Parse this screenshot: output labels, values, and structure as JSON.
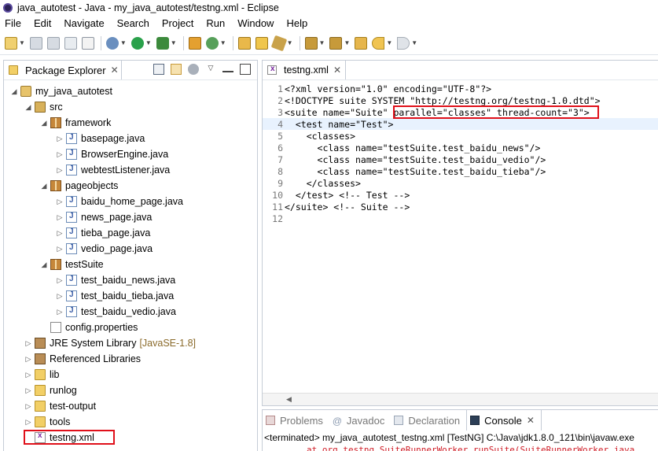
{
  "window": {
    "title": "java_autotest - Java - my_java_autotest/testng.xml - Eclipse"
  },
  "menubar": {
    "items": [
      "File",
      "Edit",
      "Navigate",
      "Search",
      "Project",
      "Run",
      "Window",
      "Help"
    ]
  },
  "package_explorer": {
    "tab_label": "Package Explorer",
    "tree": [
      {
        "label": "my_java_autotest",
        "icon": "project-icon"
      },
      {
        "label": "src",
        "icon": "source-folder-icon"
      },
      {
        "label": "framework",
        "icon": "package-icon"
      },
      {
        "label": "basepage.java",
        "icon": "java-file-icon"
      },
      {
        "label": "BrowserEngine.java",
        "icon": "java-file-icon"
      },
      {
        "label": "webtestListener.java",
        "icon": "java-file-icon"
      },
      {
        "label": "pageobjects",
        "icon": "package-icon"
      },
      {
        "label": "baidu_home_page.java",
        "icon": "java-file-icon"
      },
      {
        "label": "news_page.java",
        "icon": "java-file-icon"
      },
      {
        "label": "tieba_page.java",
        "icon": "java-file-icon"
      },
      {
        "label": "vedio_page.java",
        "icon": "java-file-icon"
      },
      {
        "label": "testSuite",
        "icon": "package-icon"
      },
      {
        "label": "test_baidu_news.java",
        "icon": "java-file-icon"
      },
      {
        "label": "test_baidu_tieba.java",
        "icon": "java-file-icon"
      },
      {
        "label": "test_baidu_vedio.java",
        "icon": "java-file-icon"
      },
      {
        "label": "config.properties",
        "icon": "properties-file-icon"
      },
      {
        "label": "JRE System Library",
        "tag": "[JavaSE-1.8]",
        "icon": "library-icon"
      },
      {
        "label": "Referenced Libraries",
        "icon": "library-icon"
      },
      {
        "label": "lib",
        "icon": "folder-icon"
      },
      {
        "label": "runlog",
        "icon": "folder-icon"
      },
      {
        "label": "test-output",
        "icon": "folder-icon"
      },
      {
        "label": "tools",
        "icon": "folder-icon"
      },
      {
        "label": "testng.xml",
        "icon": "xml-file-icon"
      }
    ]
  },
  "editor": {
    "tab_label": "testng.xml",
    "lines": [
      {
        "num": "1",
        "text": "<?xml version=\"1.0\" encoding=\"UTF-8\"?>"
      },
      {
        "num": "2",
        "text": "<!DOCTYPE suite SYSTEM \"http://testng.org/testng-1.0.dtd\">"
      },
      {
        "num": "3",
        "text": "<suite name=\"Suite\" parallel=\"classes\" thread-count=\"3\">"
      },
      {
        "num": "4",
        "text": "  <test name=\"Test\">"
      },
      {
        "num": "5",
        "text": "    <classes>"
      },
      {
        "num": "6",
        "text": "      <class name=\"testSuite.test_baidu_news\"/>"
      },
      {
        "num": "7",
        "text": "      <class name=\"testSuite.test_baidu_vedio\"/>"
      },
      {
        "num": "8",
        "text": "      <class name=\"testSuite.test_baidu_tieba\"/>"
      },
      {
        "num": "9",
        "text": "    </classes>"
      },
      {
        "num": "10",
        "text": "  </test> <!-- Test -->"
      },
      {
        "num": "11",
        "text": "</suite> <!-- Suite -->"
      },
      {
        "num": "12",
        "text": ""
      }
    ]
  },
  "console": {
    "tabs": [
      "Problems",
      "Javadoc",
      "Declaration",
      "Console"
    ],
    "active_tab": "Console",
    "status": "<terminated> my_java_autotest_testng.xml [TestNG] C:\\Java\\jdk1.8.0_121\\bin\\javaw.exe",
    "error_line": "at org.testng.SuiteRunnerWorker.runSuite(SuiteRunnerWorker.java"
  },
  "colors": {
    "highlight": "#e0101a",
    "current_line": "#e8f2fe",
    "error_text": "#d0202a"
  }
}
